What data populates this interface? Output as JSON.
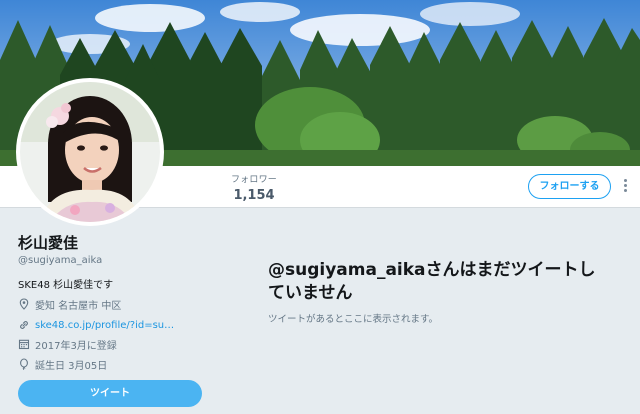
{
  "nav": {
    "followers_label": "フォロワー",
    "followers_count": "1,154",
    "follow_button": "フォローする"
  },
  "profile": {
    "name": "杉山愛佳",
    "handle": "@sugiyama_aika",
    "bio": "SKE48 杉山愛佳です",
    "location": "愛知 名古屋市 中区",
    "url": "ske48.co.jp/profile/?id=su…",
    "joined": "2017年3月に登録",
    "birthday": "誕生日 3月05日",
    "tweet_button": "ツイート"
  },
  "timeline": {
    "empty_title": "@sugiyama_aikaさんはまだツイートしていません",
    "empty_subtitle": "ツイートがあるとここに表示されます。"
  },
  "colors": {
    "accent": "#1da1f2",
    "tweet_button": "#4bb4f2",
    "background": "#e6ecf0"
  },
  "icons": {
    "location": "location-pin-icon",
    "link": "link-icon",
    "calendar": "calendar-icon",
    "birthday": "balloon-icon",
    "more": "vertical-dots-icon"
  }
}
